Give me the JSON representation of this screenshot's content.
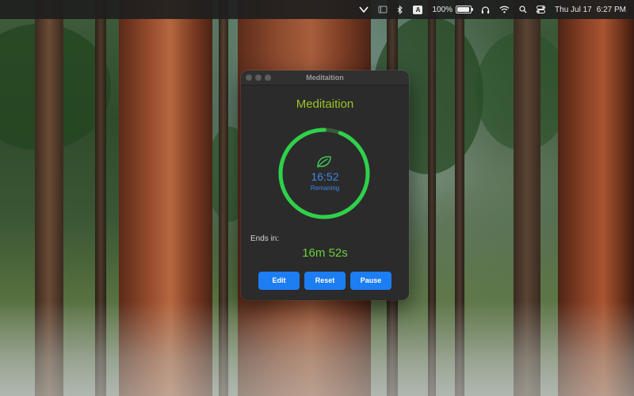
{
  "menubar": {
    "battery_percent": "100%",
    "date": "Thu Jul 17",
    "time": "6:27 PM",
    "input_badge": "A"
  },
  "window": {
    "title": "Meditaition"
  },
  "app": {
    "title": "Meditaition",
    "timer": {
      "time": "16:52",
      "label": "Remaning",
      "progress": 0.94
    },
    "ends_label": "Ends in:",
    "ends_value": "16m 52s",
    "buttons": {
      "edit": "Edit",
      "reset": "Reset",
      "pause": "Pause"
    }
  },
  "colors": {
    "accent_blue": "#1d7df2",
    "title_green": "#9ec325",
    "ring_green": "#2fd14a",
    "ends_green": "#69cf3b",
    "timer_blue": "#3f86e6"
  },
  "icons": {
    "leaf": "leaf-icon",
    "wifi": "wifi-icon",
    "bluetooth": "bluetooth-icon",
    "headphones": "headphones-icon",
    "search": "search-icon",
    "control_center": "control-center-icon"
  }
}
